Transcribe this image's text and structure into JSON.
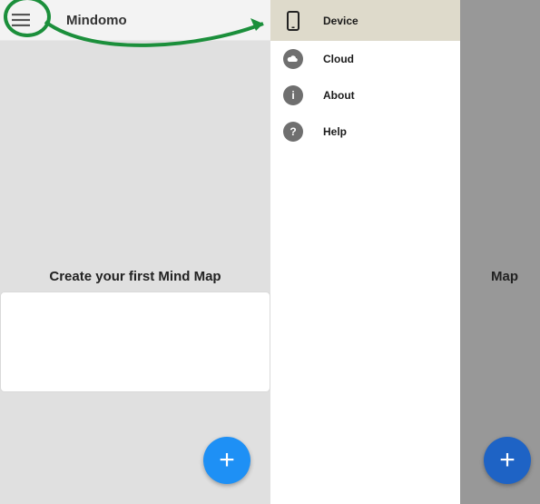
{
  "app": {
    "title": "Mindomo"
  },
  "main": {
    "prompt": "Create your first Mind Map"
  },
  "drawer": {
    "items": [
      {
        "label": "Device"
      },
      {
        "label": "Cloud"
      },
      {
        "label": "About"
      },
      {
        "label": "Help"
      }
    ]
  },
  "right": {
    "visible_text": "Map"
  }
}
